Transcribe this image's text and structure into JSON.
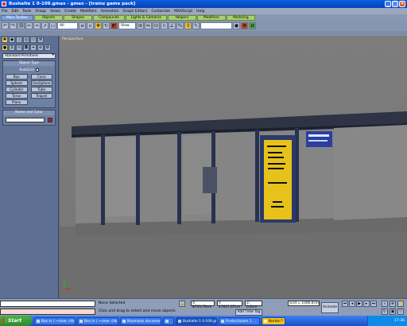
{
  "window": {
    "title": "Bushalte 1 0-109.gmax - gmax - [trainz game pack]"
  },
  "menubar": [
    "File",
    "Edit",
    "Tools",
    "Group",
    "Views",
    "Create",
    "Modifiers",
    "Animation",
    "Graph Editors",
    "Customize",
    "MAXScript",
    "Help"
  ],
  "tabs": [
    "Main Toolbar",
    "Objects",
    "Shapes",
    "Compounds",
    "Lights & Cameras",
    "Helpers",
    "Modifiers",
    "Modeling"
  ],
  "toolbar": {
    "selection_filter": "All",
    "coord_system": "View"
  },
  "command_panel": {
    "category_dropdown": "Standard Primitives",
    "object_type_header": "Object Type",
    "autogrid_label": "AutoGrid",
    "object_buttons": [
      "Box",
      "Cone",
      "Sphere",
      "GeoSphere",
      "Cylinder",
      "Tube",
      "Torus",
      "Teapot",
      "Plane"
    ],
    "name_color_header": "Name and Color"
  },
  "viewport": {
    "label": "Perspective"
  },
  "status": {
    "selection": "None Selected",
    "prompt": "Click and drag to select and move objects",
    "add_time_tag": "Add Time Tag",
    "x": "X: 8735,79cm",
    "y": "Y: 27627,97cm",
    "z": "Z: 0,0cm",
    "grid": "Grid = 1000,0cm",
    "animate": "Animate"
  },
  "taskbar": {
    "start": "Start",
    "tasks": [
      "Box in ( ~view- chk...",
      "Box in ( ~view- chk...",
      "Naamloos documen...",
      "",
      "Bushalte 1 0-109.gm...",
      "Productnaam 1 ...",
      "Norton™"
    ],
    "clock": "17:36"
  }
}
